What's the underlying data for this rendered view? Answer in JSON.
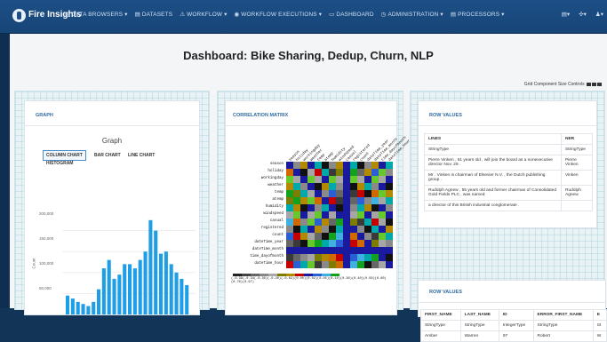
{
  "app": {
    "brand": "Fire Insights"
  },
  "nav": {
    "items": [
      {
        "icon": "◷",
        "label": "DATA BROWSERS ▾"
      },
      {
        "icon": "▤",
        "label": "DATASETS"
      },
      {
        "icon": "⚠",
        "label": "WORKFLOW ▾"
      },
      {
        "icon": "◉",
        "label": "WORKFLOW EXECUTIONS ▾"
      },
      {
        "icon": "▭",
        "label": "DASHBOARD"
      },
      {
        "icon": "◷",
        "label": "ADMINISTRATION ▾"
      },
      {
        "icon": "▤",
        "label": "PROCESSORS ▾"
      }
    ],
    "right": [
      "▤▾",
      "✣▾",
      "♟▾"
    ]
  },
  "page": {
    "title": "Dashboard: Bike Sharing, Dedup, Churn, NLP",
    "grid_controls_label": "Grid Component Size Controls"
  },
  "graph": {
    "card_title": "GRAPH",
    "title": "Graph",
    "buttons": [
      "COLUMN CHART",
      "BAR CHART",
      "LINE CHART",
      "HISTOGRAM"
    ],
    "ylabel": "Count",
    "yticks": [
      "200,000",
      "150,000",
      "100,000",
      "50,000"
    ]
  },
  "chart_data": {
    "type": "bar",
    "title": "Graph",
    "ylabel": "Count",
    "ylim": [
      0,
      250000
    ],
    "values": [
      45000,
      38000,
      30000,
      25000,
      20000,
      30000,
      60000,
      110000,
      130000,
      85000,
      95000,
      120000,
      120000,
      110000,
      130000,
      150000,
      225000,
      200000,
      145000,
      150000,
      120000,
      100000,
      85000,
      70000
    ]
  },
  "corr": {
    "card_title": "CORRELATION MATRIX",
    "labels": [
      "season",
      "holiday",
      "workingday",
      "weather",
      "temp",
      "atemp",
      "humidity",
      "windspeed",
      "casual",
      "registered",
      "count",
      "dateTime_year",
      "dateTime_month",
      "time_dayofmonth",
      "dateTime_hour"
    ],
    "palette": [
      "#111111",
      "#3a3a3a",
      "#666666",
      "#8a8a8a",
      "#a6a6a6",
      "#7d7d00",
      "#b28900",
      "#d06a00",
      "#c40000",
      "#1a1a9e",
      "#2a5fd6",
      "#3fb0e0",
      "#00a9a9",
      "#14a21e",
      "#67c82e"
    ],
    "colorbar": [
      "#222",
      "#444",
      "#666",
      "#888",
      "#aaa",
      "#7d7d00",
      "#b28900",
      "#c40000",
      "#1a1a9e",
      "#2a5fd6",
      "#3fb0e0",
      "#14a21e"
    ],
    "colorbar_labels": "(-0.39(-0.34(-0.30)(-0.20)(-0.02)(0.00)(0.02)(0.05)(0.10)(0.30)(0.40)(0.50)(0.60)(0.70)(0.97)"
  },
  "rowvalues1": {
    "card_title": "ROW VALUES",
    "headers": [
      "LINES",
      "NER"
    ],
    "rows": [
      [
        "StringType",
        "StringType"
      ],
      [
        "Pierre Vinken , 61 years old , will join the board as a nonexecutive director Nov. 29 .",
        "Pierre Vinken"
      ],
      [
        "Mr . Vinken is chairman of Elsevier N.V. , the Dutch publishing group .",
        "Vinken"
      ],
      [
        "Rudolph Agnew , 55 years old and former chairman of Consolidated Gold Fields PLC , was named",
        "Rudolph Agnew"
      ],
      [
        "a director of this British industrial conglomerate .",
        ""
      ]
    ]
  },
  "rowvalues2": {
    "card_title": "ROW VALUES",
    "headers": [
      "FIRST_NAME",
      "LAST_NAME",
      "ID",
      "ERROR_FIRST_NAME",
      "E"
    ],
    "rows": [
      [
        "StringType",
        "StringType",
        "IntegerType",
        "StringType",
        "St"
      ],
      [
        "Amber",
        "Warren",
        "97",
        "Robert",
        "W"
      ]
    ]
  }
}
